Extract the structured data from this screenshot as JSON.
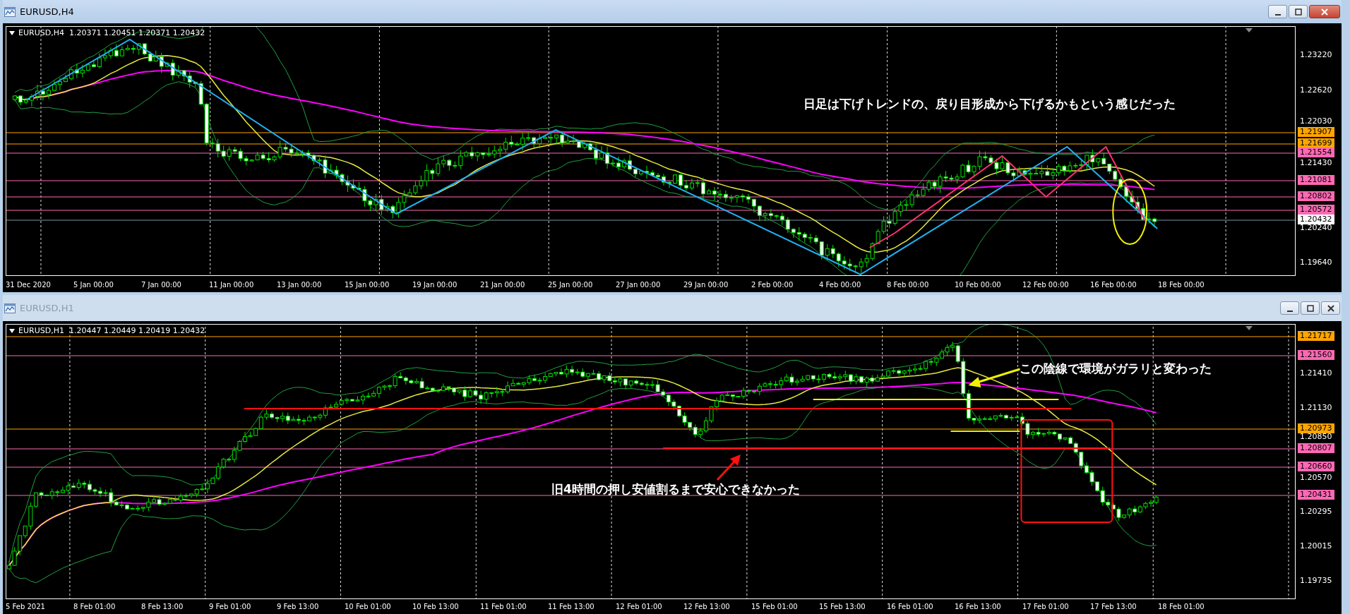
{
  "windows": [
    {
      "title": "EURUSD,H4",
      "active": true,
      "header": {
        "symbol": "EURUSD,H4",
        "ohlc": [
          "1.20371",
          "1.20451",
          "1.20371",
          "1.20432"
        ]
      },
      "price_axis": [
        "1.23220",
        "1.22620",
        "1.22030",
        "1.21430",
        "1.20240",
        "1.19640"
      ],
      "price_tags": [
        {
          "label": "1.21907",
          "color": "#ffa500",
          "kind": "line"
        },
        {
          "label": "1.21699",
          "color": "#ffa500",
          "kind": "line"
        },
        {
          "label": "1.21554",
          "color": "#ff69b4",
          "kind": "line"
        },
        {
          "label": "1.21081",
          "color": "#ff69b4",
          "kind": "line"
        },
        {
          "label": "1.20802",
          "color": "#ff69b4",
          "kind": "line"
        },
        {
          "label": "1.20572",
          "color": "#ff69b4",
          "kind": "line"
        },
        {
          "label": "1.20432",
          "color": "#ffffff",
          "kind": "bid"
        }
      ],
      "time_axis": [
        "31 Dec 2020",
        "5 Jan 00:00",
        "7 Jan 00:00",
        "11 Jan 00:00",
        "13 Jan 00:00",
        "15 Jan 00:00",
        "19 Jan 00:00",
        "21 Jan 00:00",
        "25 Jan 00:00",
        "27 Jan 00:00",
        "29 Jan 00:00",
        "2 Feb 00:00",
        "4 Feb 00:00",
        "8 Feb 00:00",
        "10 Feb 00:00",
        "12 Feb 00:00",
        "16 Feb 00:00",
        "18 Feb 00:00"
      ],
      "annotations": [
        {
          "text": "日足は下げトレンドの、戻り目形成から下げるかもという感じだった"
        }
      ]
    },
    {
      "title": "EURUSD,H1",
      "active": false,
      "header": {
        "symbol": "EURUSD,H1",
        "ohlc": [
          "1.20447",
          "1.20449",
          "1.20419",
          "1.20432"
        ]
      },
      "price_axis": [
        "1.21410",
        "1.21130",
        "1.20850",
        "1.20570",
        "1.20295",
        "1.20015",
        "1.19735"
      ],
      "price_tags": [
        {
          "label": "1.21717",
          "color": "#ffa500",
          "kind": "line"
        },
        {
          "label": "1.21560",
          "color": "#ff69b4",
          "kind": "line"
        },
        {
          "label": "1.20973",
          "color": "#ffa500",
          "kind": "line"
        },
        {
          "label": "1.20807",
          "color": "#ff69b4",
          "kind": "line"
        },
        {
          "label": "1.20660",
          "color": "#ff69b4",
          "kind": "line"
        },
        {
          "label": "1.20431",
          "color": "#ff69b4",
          "kind": "line"
        }
      ],
      "time_axis": [
        "5 Feb 2021",
        "8 Feb 01:00",
        "8 Feb 13:00",
        "9 Feb 01:00",
        "9 Feb 13:00",
        "10 Feb 01:00",
        "10 Feb 13:00",
        "11 Feb 01:00",
        "11 Feb 13:00",
        "12 Feb 01:00",
        "12 Feb 13:00",
        "15 Feb 01:00",
        "15 Feb 13:00",
        "16 Feb 01:00",
        "16 Feb 13:00",
        "17 Feb 01:00",
        "17 Feb 13:00",
        "18 Feb 01:00"
      ],
      "annotations": [
        {
          "text": "この陰線で環境がガラリと変わった"
        },
        {
          "text": "旧4時間の押し安値割るまで安心できなかった"
        }
      ]
    }
  ]
}
